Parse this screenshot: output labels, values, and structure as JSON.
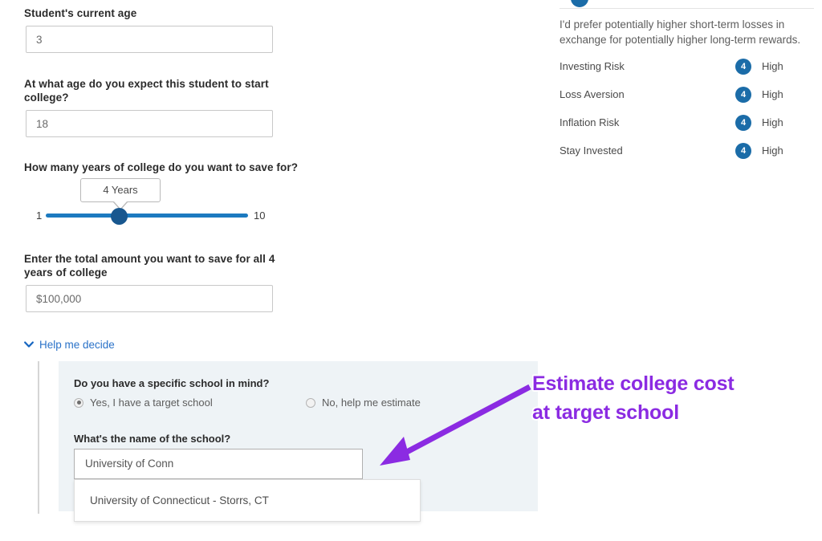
{
  "form": {
    "current_age": {
      "label": "Student's current age",
      "value": "3"
    },
    "start_college_age": {
      "label": "At what age do you expect this student to start college?",
      "value": "18"
    },
    "years_of_college": {
      "label": "How many years of college do you want to save for?",
      "tooltip_value": "4 Years",
      "slider_min_label": "1",
      "slider_max_label": "10",
      "slider_min": 1,
      "slider_max": 10,
      "slider_value": 4
    },
    "total_amount": {
      "label": "Enter the total amount you want to save for all 4 years of college",
      "value": "$100,000"
    }
  },
  "help_me_decide": {
    "toggle_label": "Help me decide",
    "toggle_icon": "chevron-down-icon",
    "school_question_label": "Do you have a specific school in mind?",
    "options": [
      {
        "label": "Yes, I have a target school",
        "selected": true
      },
      {
        "label": "No, help me estimate",
        "selected": false
      }
    ],
    "school_name_label": "What's the name of the school?",
    "school_name_value": "University of Conn",
    "suggestions": [
      "University of Connecticut - Storrs, CT"
    ]
  },
  "risk_profile": {
    "description": "I'd prefer potentially higher short-term losses in exchange for potentially higher long-term rewards.",
    "rows": [
      {
        "name": "Investing Risk",
        "score": "4",
        "level": "High"
      },
      {
        "name": "Loss Aversion",
        "score": "4",
        "level": "High"
      },
      {
        "name": "Inflation Risk",
        "score": "4",
        "level": "High"
      },
      {
        "name": "Stay Invested",
        "score": "4",
        "level": "High"
      }
    ]
  },
  "annotation": {
    "line1": "Estimate college cost",
    "line2": "at target school",
    "color": "#8b2be2",
    "icon": "arrow-pointing-down-left-icon"
  }
}
